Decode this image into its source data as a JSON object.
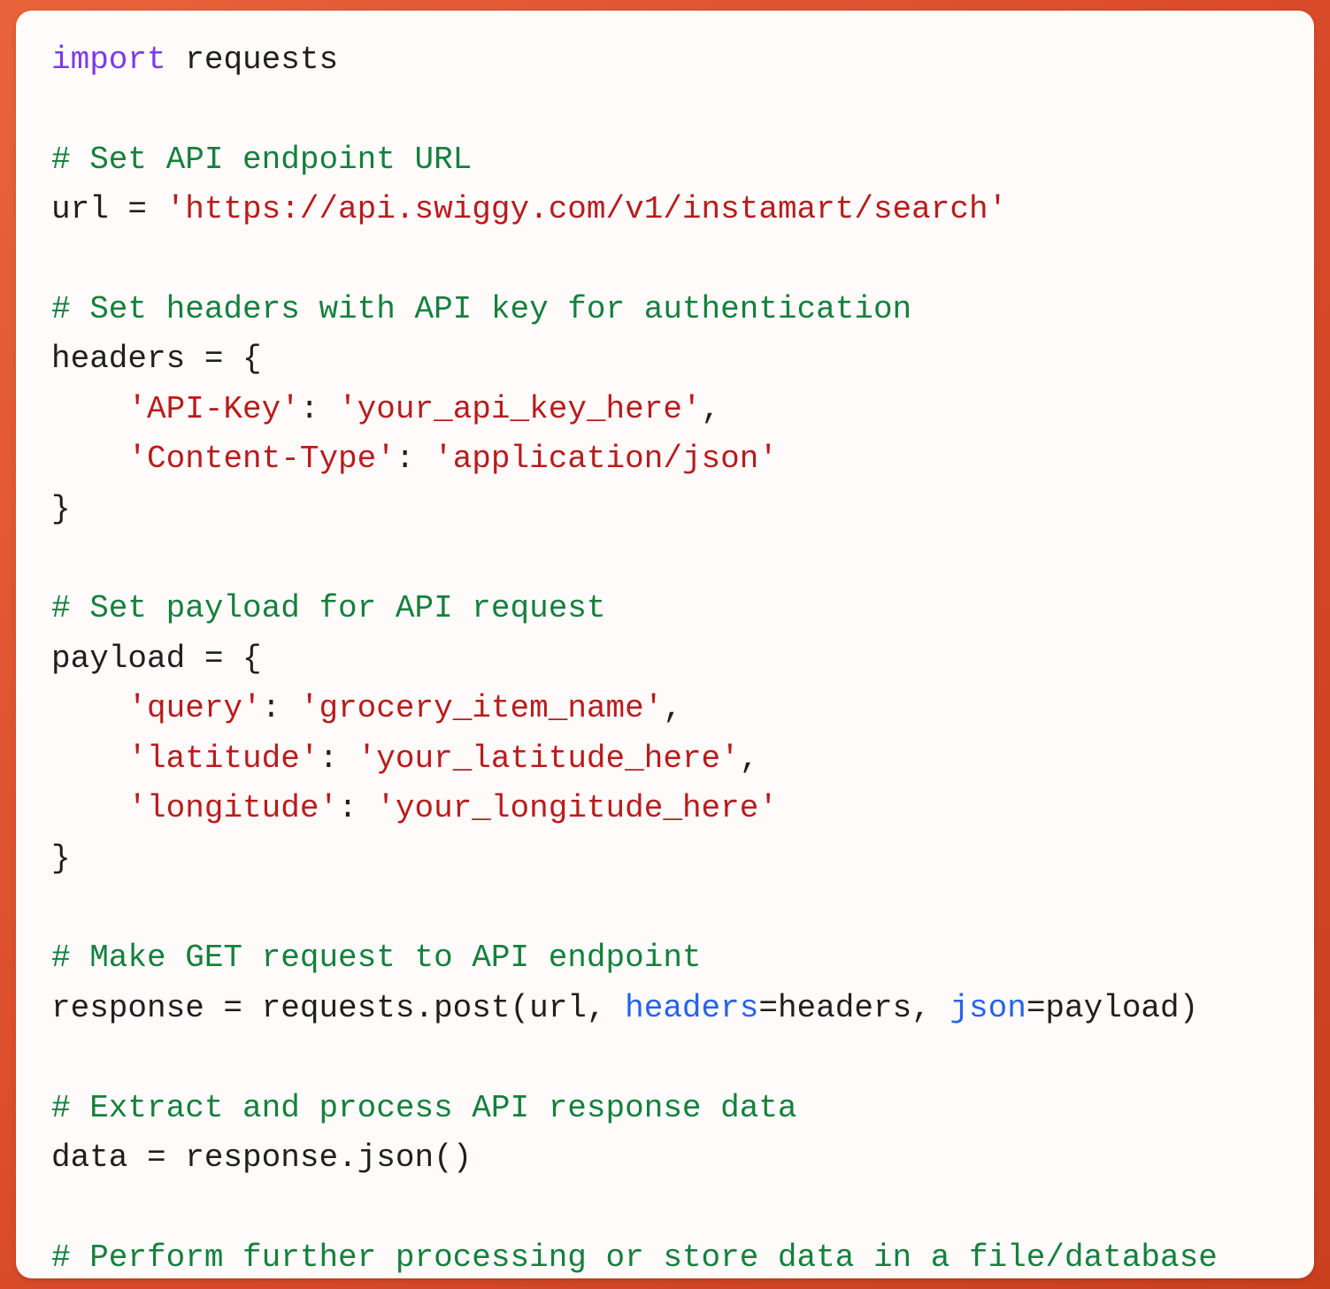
{
  "code": {
    "l1": {
      "import_kw": "import",
      "module": "requests"
    },
    "l3_comment": "# Set API endpoint URL",
    "l4": {
      "lhs": "url = ",
      "str": "'https://api.swiggy.com/v1/instamart/search'"
    },
    "l6_comment": "# Set headers with API key for authentication",
    "l7": "headers = {",
    "l8": {
      "indent": "    ",
      "k": "'API-Key'",
      "sep": ": ",
      "v": "'your_api_key_here'",
      "tail": ","
    },
    "l9": {
      "indent": "    ",
      "k": "'Content-Type'",
      "sep": ": ",
      "v": "'application/json'",
      "tail": ""
    },
    "l10": "}",
    "l12_comment": "# Set payload for API request",
    "l13": "payload = {",
    "l14": {
      "indent": "    ",
      "k": "'query'",
      "sep": ": ",
      "v": "'grocery_item_name'",
      "tail": ","
    },
    "l15": {
      "indent": "    ",
      "k": "'latitude'",
      "sep": ": ",
      "v": "'your_latitude_here'",
      "tail": ","
    },
    "l16": {
      "indent": "    ",
      "k": "'longitude'",
      "sep": ": ",
      "v": "'your_longitude_here'",
      "tail": ""
    },
    "l17": "}",
    "l19_comment": "# Make GET request to API endpoint",
    "l20": {
      "a": "response = requests.post(url, ",
      "kw1": "headers",
      "b": "=headers, ",
      "kw2": "json",
      "c": "=payload)"
    },
    "l22_comment": "# Extract and process API response data",
    "l23": "data = response.json()",
    "l25_comment": "# Perform further processing or store data in a file/database"
  }
}
